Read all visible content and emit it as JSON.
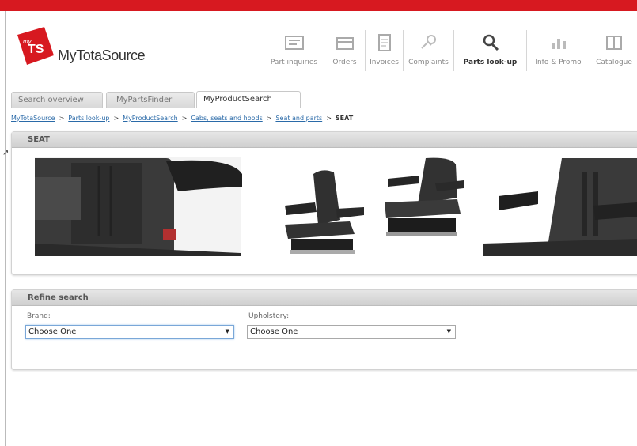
{
  "brand": {
    "badge_text": "TS",
    "badge_small": "my",
    "name": "MyTotaSource",
    "accent": "#d71920"
  },
  "toolbar": [
    {
      "label": "Part inquiries",
      "icon": "part-inquiries-icon",
      "active": false
    },
    {
      "label": "Orders",
      "icon": "orders-icon",
      "active": false
    },
    {
      "label": "Invoices",
      "icon": "invoices-icon",
      "active": false
    },
    {
      "label": "Complaints",
      "icon": "complaints-icon",
      "active": false
    },
    {
      "label": "Parts look-up",
      "icon": "search-icon",
      "active": true
    },
    {
      "label": "Info & Promo",
      "icon": "chart-icon",
      "active": false
    },
    {
      "label": "Catalogue",
      "icon": "catalogue-icon",
      "active": false
    }
  ],
  "tabs": [
    {
      "label": "Search overview",
      "active": false
    },
    {
      "label": "MyPartsFinder",
      "active": false
    },
    {
      "label": "MyProductSearch",
      "active": true
    }
  ],
  "breadcrumb": {
    "links": [
      "MyTotaSource",
      "Parts look-up",
      "MyProductSearch",
      "Cabs, seats and hoods",
      "Seat and parts"
    ],
    "separator": ">",
    "current": "SEAT"
  },
  "seat_panel": {
    "title": "SEAT"
  },
  "refine": {
    "title": "Refine search",
    "brand_label": "Brand:",
    "brand_value": "Choose One",
    "upholstery_label": "Upholstery:",
    "upholstery_value": "Choose One"
  }
}
